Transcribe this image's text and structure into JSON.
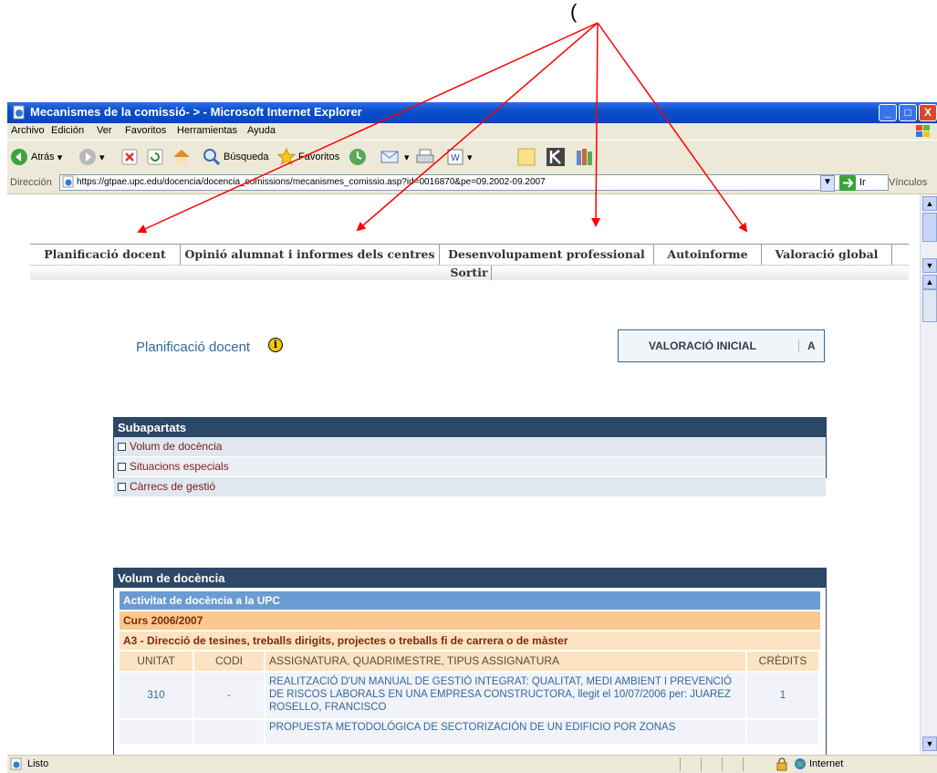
{
  "annotation_text": "(",
  "window": {
    "title": "Mecanismes de la comissió- > - Microsoft Internet Explorer",
    "min": "_",
    "max": "□",
    "close": "X"
  },
  "menu": [
    "Archivo",
    "Edición",
    "Ver",
    "Favoritos",
    "Herramientas",
    "Ayuda"
  ],
  "toolbar": {
    "back": "Atrás",
    "search": "Búsqueda",
    "favorites": "Favoritos"
  },
  "address": {
    "label": "Dirección",
    "url": "https://gtpae.upc.edu/docencia/docencia_comissions/mecanismes_comissio.asp?id=0016870&pe=09.2002-09.2007",
    "go": "Ir",
    "links": "Vínculos"
  },
  "nav": {
    "items": [
      "Planificació docent",
      "Opinió alumnat i informes dels centres",
      "Desenvolupament professional",
      "Autoinforme",
      "Valoració global"
    ],
    "exit": "Sortir"
  },
  "section": {
    "title": "Planificació docent",
    "info_icon": "i",
    "valoracio_label": "VALORACIÓ INICIAL",
    "valoracio_value": "A"
  },
  "subapartats": {
    "title": "Subapartats",
    "items": [
      "Volum de docència",
      "Situacions especials",
      "Càrrecs de gestió"
    ]
  },
  "volum": {
    "title": "Volum de docència",
    "activitat": "Activitat de docència a la UPC",
    "curs": "Curs 2006/2007",
    "a3": "A3 - Direcció de tesines, treballs dirigits, projectes o treballs fi de carrera o de màster",
    "headers": [
      "UNITAT",
      "CODI",
      "ASSIGNATURA, QUADRIMESTRE, TIPUS ASSIGNATURA",
      "CRÈDITS"
    ],
    "rows": [
      {
        "unitat": "310",
        "codi": "-",
        "assignatura": "REALITZACIÓ D'UN MANUAL DE GESTIÓ INTEGRAT: QUALITAT, MEDI AMBIENT I PREVENCIÓ DE RISCOS LABORALS EN UNA EMPRESA CONSTRUCTORA, llegit el 10/07/2006 per: JUAREZ ROSELLO, FRANCISCO",
        "credits": "1"
      },
      {
        "unitat": "",
        "codi": "",
        "assignatura": "PROPUESTA METODOLÓGICA DE SECTORIZACIÓN DE UN EDIFICIO POR ZONAS",
        "credits": ""
      }
    ]
  },
  "status": {
    "text": "Listo",
    "zone": "Internet"
  },
  "colors": {
    "ie_blue": "#0a4fcc",
    "panel_dark": "#2d4766",
    "panel_light": "#6b9bd2",
    "accent_orange": "#fbc98d",
    "arrow_red": "#ff0000"
  }
}
